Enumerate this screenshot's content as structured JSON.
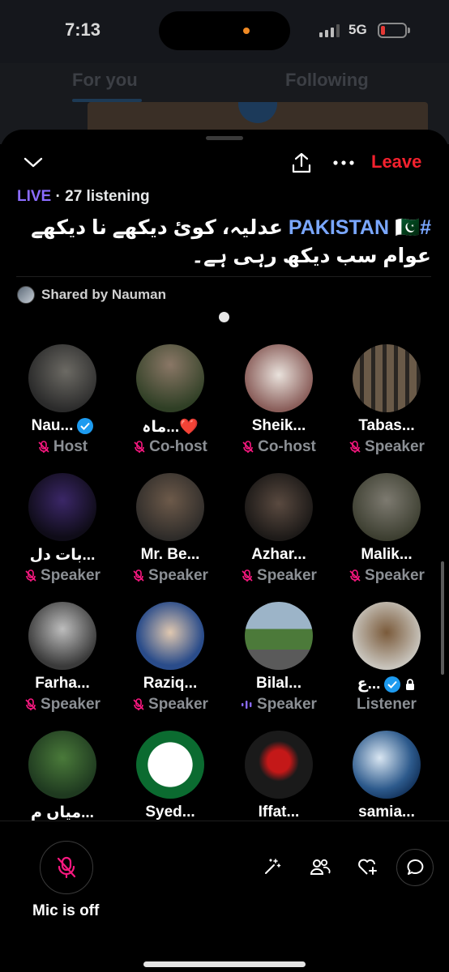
{
  "status_bar": {
    "time": "7:13",
    "network": "5G",
    "battery_color": "#e53935"
  },
  "feed": {
    "tabs": [
      "For you",
      "Following"
    ]
  },
  "sheet": {
    "leave_label": "Leave",
    "live_label": "LIVE",
    "listening_label": "· 27 listening",
    "title_hashtag": "#PAKISTAN",
    "title_flag": "🇵🇰",
    "title_rest": "عدلیہ، کوئ دیکھے نا دیکھے عوام سب دیکھ رہی ہے۔",
    "shared_by": "Shared by Nauman"
  },
  "participants": [
    {
      "name": "Nau...",
      "role": "Host",
      "verified": true,
      "muted": true
    },
    {
      "name": "ماہ...❤️",
      "role": "Co-host",
      "muted": true
    },
    {
      "name": "Sheik...",
      "role": "Co-host",
      "muted": true
    },
    {
      "name": "Tabas...",
      "role": "Speaker",
      "muted": true
    },
    {
      "name": "بات دل...",
      "role": "Speaker",
      "muted": true
    },
    {
      "name": "Mr. Be...",
      "role": "Speaker",
      "muted": true
    },
    {
      "name": "Azhar...",
      "role": "Speaker",
      "muted": true
    },
    {
      "name": "Malik...",
      "role": "Speaker",
      "muted": true
    },
    {
      "name": "Farha...",
      "role": "Speaker",
      "muted": true
    },
    {
      "name": "Raziq...",
      "role": "Speaker",
      "muted": true
    },
    {
      "name": "Bilal...",
      "role": "Speaker",
      "speaking": true
    },
    {
      "name": "ع...",
      "role": "Listener",
      "verified": true,
      "locked": true
    },
    {
      "name": "میاں م...",
      "role": ""
    },
    {
      "name": "Syed...",
      "role": ""
    },
    {
      "name": "Iffat...",
      "role": ""
    },
    {
      "name": "samia...",
      "role": ""
    }
  ],
  "bottom": {
    "mic_label": "Mic is off"
  },
  "colors": {
    "live": "#8b6cff",
    "leave": "#f4212e",
    "mute": "#f91880",
    "hashtag": "#7aa7ff",
    "verified": "#1d9bf0"
  }
}
